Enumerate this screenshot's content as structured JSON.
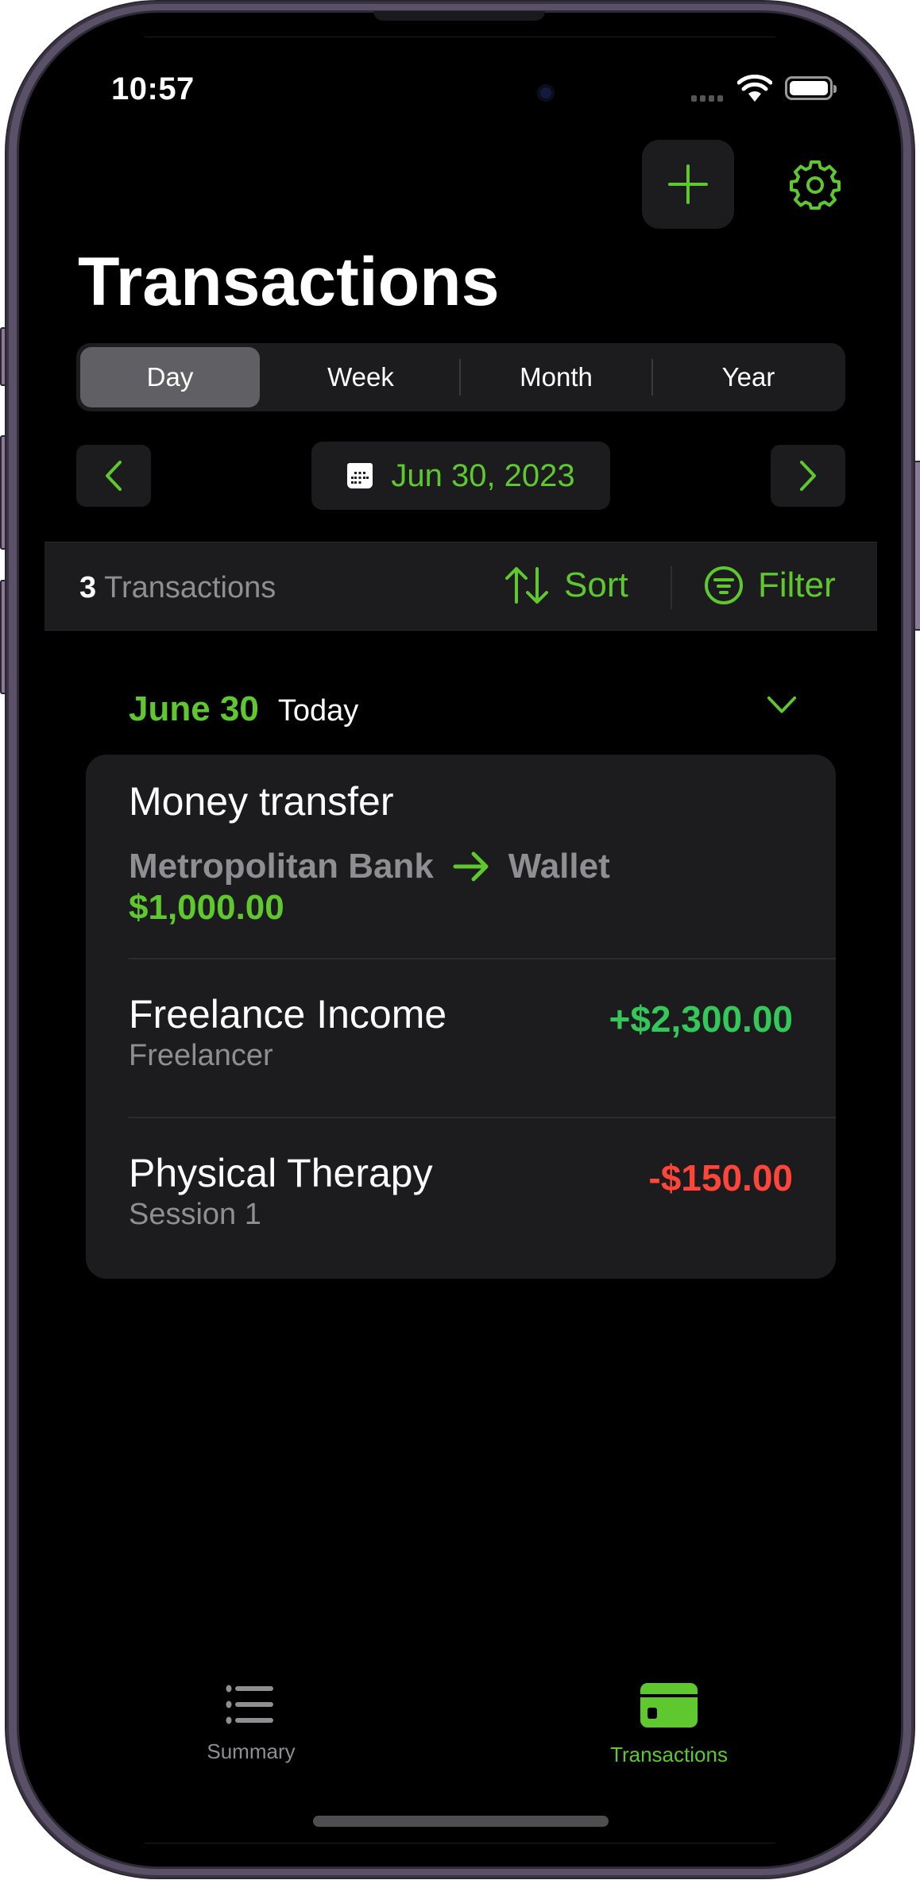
{
  "status_bar": {
    "time": "10:57",
    "icons": [
      "signal-dots-icon",
      "wifi-icon",
      "battery-icon"
    ]
  },
  "header": {
    "add_icon": "plus-icon",
    "settings_icon": "gear-icon",
    "title": "Transactions"
  },
  "period_selector": {
    "options": [
      {
        "label": "Day",
        "selected": true
      },
      {
        "label": "Week",
        "selected": false
      },
      {
        "label": "Month",
        "selected": false
      },
      {
        "label": "Year",
        "selected": false
      }
    ]
  },
  "date_nav": {
    "prev_icon": "chevron-left-icon",
    "next_icon": "chevron-right-icon",
    "calendar_icon": "calendar-icon",
    "date": "Jun 30, 2023"
  },
  "toolbar": {
    "count": "3",
    "count_label": "Transactions",
    "sort_label": "Sort",
    "filter_label": "Filter"
  },
  "section": {
    "date": "June 30",
    "relative": "Today",
    "expanded": true
  },
  "transactions": [
    {
      "type": "transfer",
      "title": "Money transfer",
      "from": "Metropolitan Bank",
      "to": "Wallet",
      "amount": "$1,000.00"
    },
    {
      "type": "income",
      "title": "Freelance Income",
      "subtitle": "Freelancer",
      "amount": "+$2,300.00"
    },
    {
      "type": "expense",
      "title": "Physical Therapy",
      "subtitle": "Session 1",
      "amount": "-$150.00"
    }
  ],
  "tab_bar": {
    "tabs": [
      {
        "label": "Summary",
        "icon": "list-icon",
        "active": false
      },
      {
        "label": "Transactions",
        "icon": "credit-card-icon",
        "active": true
      }
    ]
  },
  "colors": {
    "accent": "#5ec82e",
    "income": "#34c759",
    "expense": "#ff453a",
    "background": "#000000",
    "card": "#1c1c1e",
    "secondary_text": "#8e8e93"
  }
}
